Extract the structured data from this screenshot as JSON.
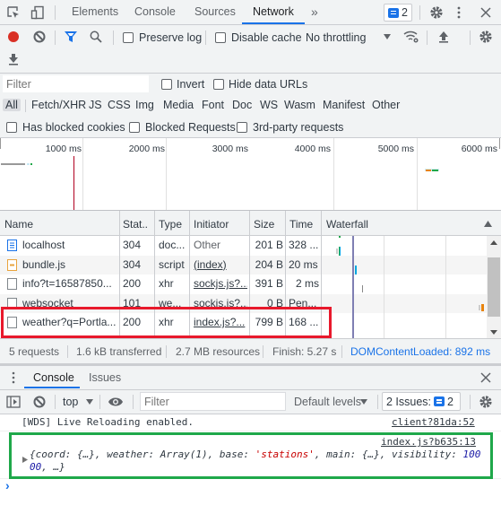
{
  "toolbar": {
    "tabs": [
      "Elements",
      "Console",
      "Sources",
      "Network"
    ],
    "active_tab": "Network",
    "more_tabs": "»",
    "issues_count": "2"
  },
  "network_toolbar": {
    "preserve_log": "Preserve log",
    "disable_cache": "Disable cache",
    "throttling": "No throttling"
  },
  "filter_bar": {
    "placeholder": "Filter",
    "invert": "Invert",
    "hide_data_urls": "Hide data URLs",
    "types": [
      "All",
      "Fetch/XHR",
      "JS",
      "CSS",
      "Img",
      "Media",
      "Font",
      "Doc",
      "WS",
      "Wasm",
      "Manifest",
      "Other"
    ],
    "active_type": "All",
    "has_blocked_cookies": "Has blocked cookies",
    "blocked_requests": "Blocked Requests",
    "third_party": "3rd-party requests"
  },
  "overview": {
    "ticks": [
      "1000 ms",
      "2000 ms",
      "3000 ms",
      "4000 ms",
      "5000 ms",
      "6000 ms"
    ]
  },
  "table": {
    "headers": [
      "Name",
      "Stat..",
      "Type",
      "Initiator",
      "Size",
      "Time",
      "Waterfall"
    ],
    "rows": [
      {
        "name": "localhost",
        "status": "304",
        "type": "doc...",
        "initiator": "Other",
        "size": "201 B",
        "time": "328 ...",
        "icon": "document-icon"
      },
      {
        "name": "bundle.js",
        "status": "304",
        "type": "script",
        "initiator": "(index)",
        "size": "204 B",
        "time": "20 ms",
        "icon": "script-icon"
      },
      {
        "name": "info?t=16587850...",
        "status": "200",
        "type": "xhr",
        "initiator": "sockjs.js?...",
        "size": "391 B",
        "time": "2 ms",
        "icon": "file-icon"
      },
      {
        "name": "websocket",
        "status": "101",
        "type": "we...",
        "initiator": "sockjs.js?...",
        "size": "0 B",
        "time": "Pen...",
        "icon": "file-icon"
      },
      {
        "name": "weather?q=Portla...",
        "status": "200",
        "type": "xhr",
        "initiator": "index.js?...",
        "size": "799 B",
        "time": "168 ...",
        "icon": "file-icon"
      }
    ]
  },
  "summary": {
    "requests": "5 requests",
    "transferred": "1.6 kB transferred",
    "resources": "2.7 MB resources",
    "finish": "Finish: 5.27 s",
    "dcl": "DOMContentLoaded: 892 ms"
  },
  "drawer": {
    "tabs": [
      "Console",
      "Issues"
    ],
    "active_tab": "Console",
    "context": "top",
    "filter_placeholder": "Filter",
    "levels": "Default levels",
    "issues_label": "2 Issues:",
    "issues_count": "2"
  },
  "console": {
    "messages": [
      {
        "text": "[WDS] Live Reloading enabled.",
        "source": "client?81da:52"
      },
      {
        "source": "index.js?b635:13",
        "obj_pre": "{coord: {…}, weather: Array(1), base: ",
        "obj_str": "'stations'",
        "obj_mid": ", main: {…}, visibility: ",
        "obj_num1": "100",
        "obj_num2": "00",
        "obj_end": ", …}"
      }
    ],
    "prompt": "›"
  },
  "annotations": {
    "red_box_color": "#e8192c",
    "green_box_color": "#1fa84a"
  }
}
